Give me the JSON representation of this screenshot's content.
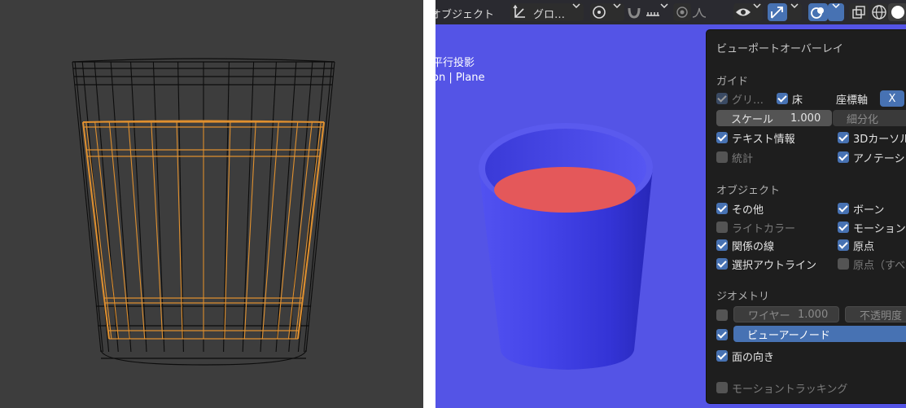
{
  "header": {
    "mode_label": "オブジェクト",
    "transform_label": "グロ…"
  },
  "viewport": {
    "projection_label": "平行投影",
    "collection_label": "on | Plane"
  },
  "popover": {
    "title": "ビューポートオーバーレイ",
    "guides": {
      "section": "ガイド",
      "grid": "グリ…",
      "floor": "床",
      "axes": "座標軸",
      "axis_x": "X",
      "scale_label": "スケール",
      "scale_value": "1.000",
      "subdivisions": "細分化",
      "text_info": "テキスト情報",
      "cursor_3d": "3Dカーソル",
      "stats": "統計",
      "annotations": "アノテーシ"
    },
    "objects": {
      "section": "オブジェクト",
      "extras": "その他",
      "bones": "ボーン",
      "light_colors": "ライトカラー",
      "motion_paths": "モーション",
      "relationship_lines": "関係の線",
      "origins": "原点",
      "outline_selected": "選択アウトライン",
      "origins_all": "原点（すべ"
    },
    "geometry": {
      "section": "ジオメトリ",
      "wireframe_label": "ワイヤー",
      "wireframe_value": "1.000",
      "opacity_label": "不透明度",
      "viewer_node": "ビューアーノード",
      "face_orientation": "面の向き"
    },
    "motion_tracking": "モーショントラッキング"
  },
  "colors": {
    "left_bg": "#3d3d3d",
    "viewport_bg": "#5454e6",
    "cup_blue": "#3d3ddc",
    "liquid_red": "#e4585a",
    "selection_orange": "#e0902f",
    "accent_blue": "#4772b3"
  }
}
